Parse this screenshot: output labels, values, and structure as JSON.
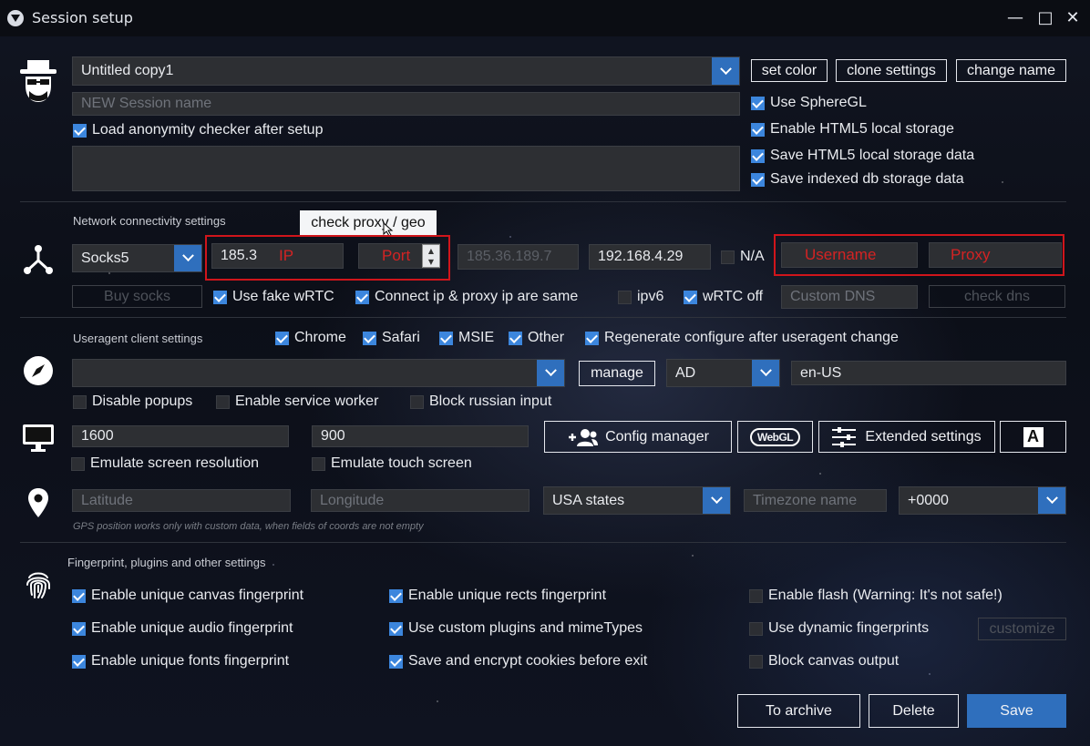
{
  "window": {
    "title": "Session setup",
    "controls": {
      "minimize": "—",
      "maximize": "□",
      "close": "✕"
    }
  },
  "session": {
    "name_value": "Untitled copy1",
    "new_name_placeholder": "NEW Session name",
    "load_anonymity_checker": {
      "label": "Load anonymity checker after setup",
      "checked": true
    },
    "buttons": {
      "set_color": "set color",
      "clone_settings": "clone settings",
      "change_name": "change name"
    },
    "options": [
      {
        "label": "Use SphereGL",
        "checked": true
      },
      {
        "label": "Enable HTML5 local storage",
        "checked": true
      },
      {
        "label": "Save HTML5 local storage data",
        "checked": true
      },
      {
        "label": "Save indexed db storage data",
        "checked": true
      }
    ]
  },
  "network": {
    "section_label": "Network connectivity settings",
    "check_proxy_button": "check proxy / geo",
    "proxy_type": "Socks5",
    "ip_value": "185.3",
    "ip_annotation": "IP",
    "port_annotation": "Port",
    "external_ip": "185.36.189.7",
    "local_ip": "192.168.4.29",
    "na": {
      "label": "N/A",
      "checked": false
    },
    "username_annotation": "Username",
    "proxy_annotation": "Proxy",
    "buy_socks": "Buy socks",
    "use_fake_webrtc": {
      "label": "Use fake wRTC",
      "checked": true
    },
    "connect_ip_same": {
      "label": "Connect ip & proxy ip are same",
      "checked": true
    },
    "ipv6": {
      "label": "ipv6",
      "checked": false
    },
    "webrtc_off": {
      "label": "wRTC off",
      "checked": true
    },
    "custom_dns_placeholder": "Custom DNS",
    "check_dns": "check dns"
  },
  "useragent": {
    "section_label": "Useragent client settings",
    "browsers": [
      {
        "label": "Chrome",
        "checked": true
      },
      {
        "label": "Safari",
        "checked": true
      },
      {
        "label": "MSIE",
        "checked": true
      },
      {
        "label": "Other",
        "checked": true
      }
    ],
    "regenerate": {
      "label": "Regenerate configure after useragent change",
      "checked": true
    },
    "manage": "manage",
    "country": "AD",
    "language": "en-US",
    "disable_popups": {
      "label": "Disable popups",
      "checked": false
    },
    "service_worker": {
      "label": "Enable service worker",
      "checked": false
    },
    "block_russian": {
      "label": "Block russian input",
      "checked": false
    }
  },
  "screen": {
    "width": "1600",
    "height": "900",
    "config_manager": "Config manager",
    "webgl": "WebGL",
    "extended_settings": "Extended settings",
    "font_button": "A",
    "emulate_resolution": {
      "label": "Emulate screen resolution",
      "checked": false
    },
    "emulate_touch": {
      "label": "Emulate touch screen",
      "checked": false
    }
  },
  "geo": {
    "latitude_placeholder": "Latitude",
    "longitude_placeholder": "Longitude",
    "region": "USA states",
    "timezone_placeholder": "Timezone name",
    "offset": "+0000",
    "note": "GPS position works only with custom data, when fields of coords are not empty"
  },
  "fingerprint": {
    "section_label": "Fingerprint, plugins and other settings",
    "col1": [
      {
        "label": "Enable unique canvas fingerprint",
        "checked": true
      },
      {
        "label": "Enable unique audio fingerprint",
        "checked": true
      },
      {
        "label": "Enable unique fonts fingerprint",
        "checked": true
      }
    ],
    "col2": [
      {
        "label": "Enable unique rects fingerprint",
        "checked": true
      },
      {
        "label": "Use custom plugins and mimeTypes",
        "checked": true
      },
      {
        "label": "Save and encrypt cookies before exit",
        "checked": true
      }
    ],
    "col3": [
      {
        "label": "Enable flash (Warning: It's not safe!)",
        "checked": false
      },
      {
        "label": "Use dynamic fingerprints",
        "checked": false
      },
      {
        "label": "Block canvas output",
        "checked": false
      }
    ],
    "customize": "customize"
  },
  "footer": {
    "to_archive": "To archive",
    "delete": "Delete",
    "save": "Save"
  },
  "colors": {
    "accent": "#2f6fbd",
    "checkbox": "#3c86dd",
    "annotation_red": "#d0151b"
  }
}
